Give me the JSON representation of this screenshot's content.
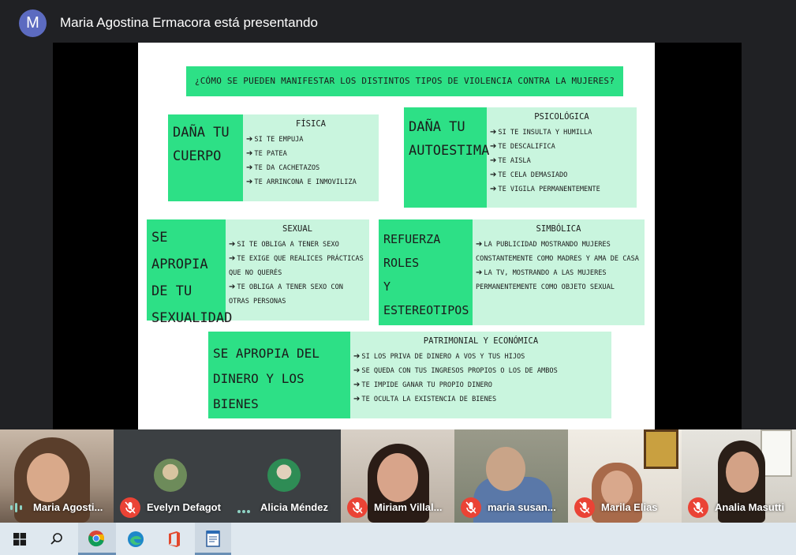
{
  "header": {
    "avatar_initial": "M",
    "presenter_text": "Maria Agostina Ermacora está presentando"
  },
  "slide": {
    "title": "¿CÓMO SE PUEDEN MANIFESTAR LOS DISTINTOS TIPOS DE VIOLENCIA CONTRA LA MUJERES?",
    "blocks": [
      {
        "label_line1": "DAÑA TU",
        "label_line2": "CUERPO",
        "heading": "FÍSICA",
        "items": [
          "SI TE EMPUJA",
          "TE PATEA",
          "TE DA CACHETAZOS",
          "TE ARRINCONA E INMOVILIZA"
        ]
      },
      {
        "label_line1": "DAÑA TU",
        "label_line2": "AUTOESTIMA",
        "heading": "PSICOLÓGICA",
        "items": [
          "SI TE INSULTA Y HUMILLA",
          "TE DESCALIFICA",
          "TE AISLA",
          "TE CELA DEMASIADO",
          "TE VIGILA PERMANENTEMENTE"
        ]
      },
      {
        "label_line1": "SE APROPIA",
        "label_line2": "DE TU",
        "label_line3": "SEXUALIDAD",
        "heading": "SEXUAL",
        "items": [
          "SI TE OBLIGA A TENER SEXO",
          "TE EXIGE QUE REALICES PRÁCTICAS QUE NO QUERÉS",
          "TE OBLIGA A TENER SEXO CON OTRAS PERSONAS"
        ]
      },
      {
        "label_line1": "REFUERZA ROLES",
        "label_line2": "Y ESTEREOTIPOS",
        "heading": "SIMBÓLICA",
        "items": [
          "LA PUBLICIDAD MOSTRANDO MUJERES CONSTANTEMENTE COMO MADRES Y AMA DE CASA",
          "LA TV, MOSTRANDO A LAS MUJERES PERMANENTEMENTE COMO OBJETO SEXUAL"
        ]
      },
      {
        "label_line1": "SE APROPIA DEL",
        "label_line2": "DINERO Y LOS BIENES",
        "heading": "PATRIMONIAL Y ECONÓMICA",
        "items": [
          "SI LOS PRIVA DE DINERO A VOS Y TUS HIJOS",
          "SE QUEDA CON TUS INGRESOS PROPIOS O LOS DE AMBOS",
          "TE IMPIDE GANAR TU PROPIO DINERO",
          "TE OCULTA LA EXISTENCIA DE BIENES"
        ]
      }
    ]
  },
  "participants": [
    {
      "name": "Maria Agosti...",
      "status": "speaking"
    },
    {
      "name": "Evelyn Defagot",
      "status": "muted"
    },
    {
      "name": "Alicia Méndez",
      "status": "more"
    },
    {
      "name": "Miriam Villal...",
      "status": "muted"
    },
    {
      "name": "maria susan...",
      "status": "muted"
    },
    {
      "name": "Marila Elias",
      "status": "muted"
    },
    {
      "name": "Analia Masutti",
      "status": "muted"
    }
  ],
  "taskbar": {
    "items": [
      "windows-start",
      "search",
      "chrome",
      "edge",
      "office",
      "notepad"
    ]
  },
  "colors": {
    "accent_green": "#2de086",
    "light_green": "#c9f5de",
    "mic_off_red": "#ea4335",
    "meet_dark": "#202124"
  }
}
